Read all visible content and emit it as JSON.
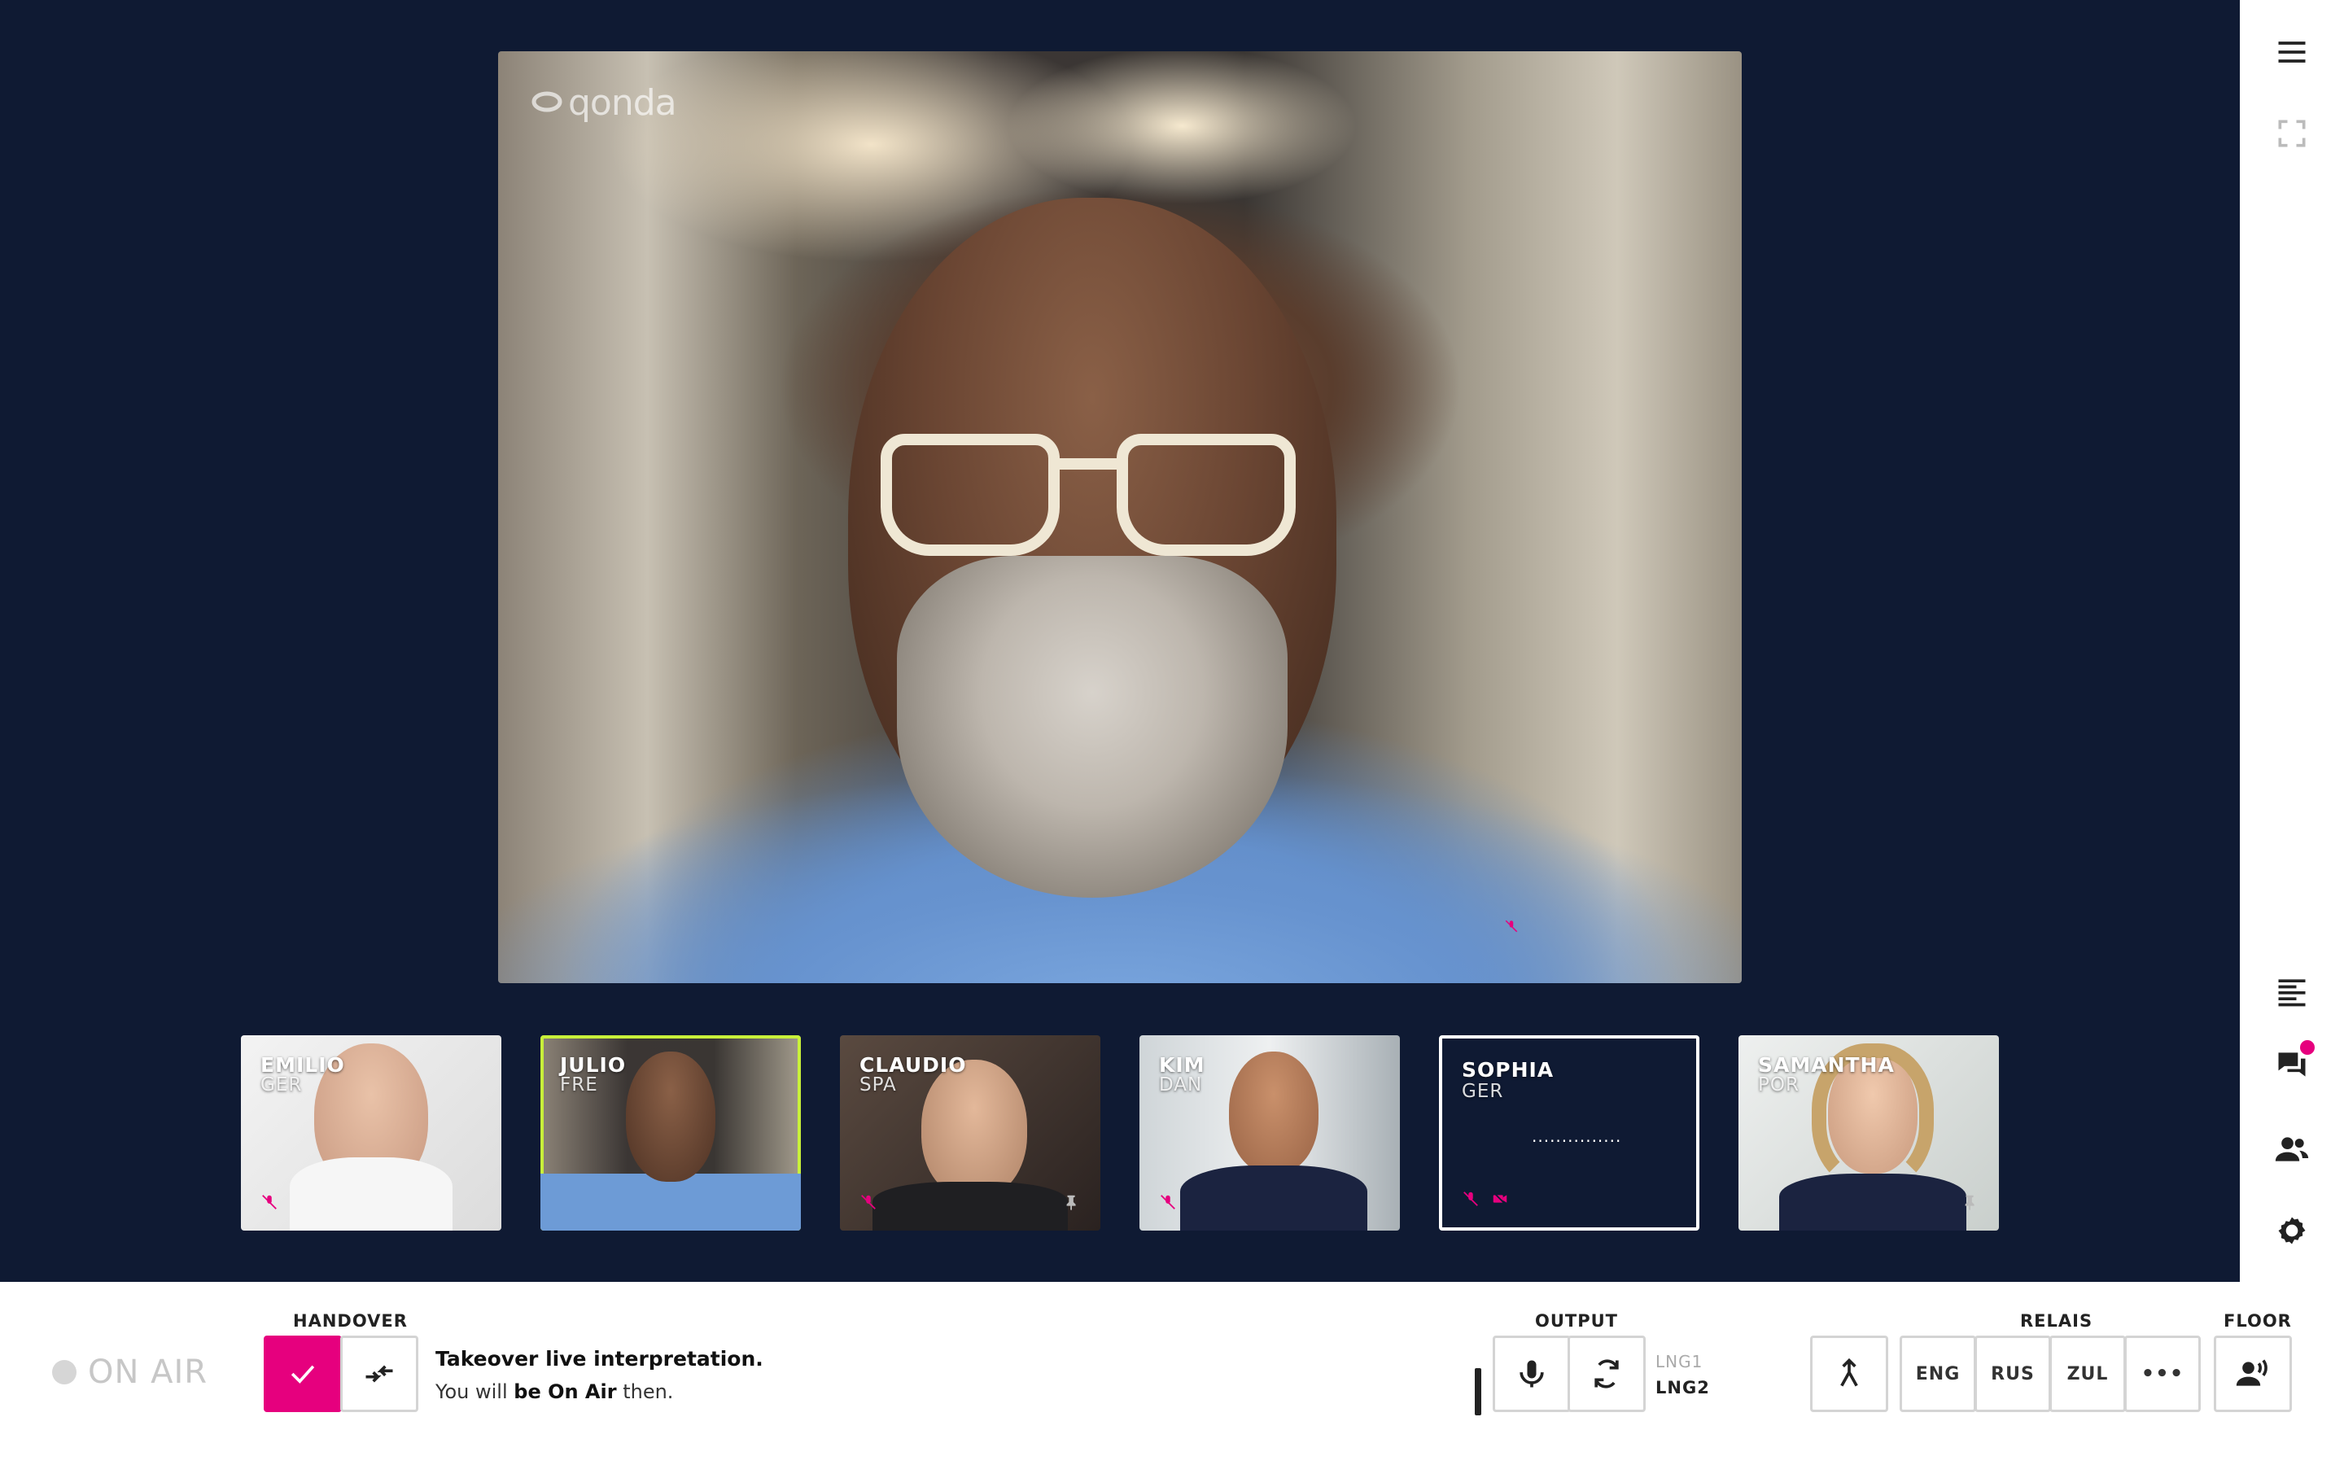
{
  "app": {
    "logo_text": "qonda"
  },
  "participants": [
    {
      "name": "EMILIO",
      "lang": "GER",
      "muted": true,
      "pinned": false,
      "active": false,
      "video": true
    },
    {
      "name": "JULIO",
      "lang": "FRE",
      "muted": false,
      "pinned": false,
      "active": true,
      "video": true
    },
    {
      "name": "CLAUDIO",
      "lang": "SPA",
      "muted": true,
      "pinned": true,
      "active": false,
      "video": true
    },
    {
      "name": "KIM",
      "lang": "DAN",
      "muted": true,
      "pinned": false,
      "active": false,
      "video": true
    },
    {
      "name": "SOPHIA",
      "lang": "GER",
      "muted": true,
      "pinned": false,
      "active": false,
      "video": false,
      "placeholder": "..............."
    },
    {
      "name": "SAMANTHA",
      "lang": "POR",
      "muted": false,
      "pinned": true,
      "active": false,
      "video": true
    }
  ],
  "sidebar": {
    "menu_icon": "hamburger-icon",
    "fullscreen_icon": "fullscreen-icon",
    "transcript_icon": "text-align-icon",
    "chat_icon": "chat-icon",
    "chat_has_notification": true,
    "participants_icon": "people-icon",
    "settings_icon": "gear-icon"
  },
  "bottom_bar": {
    "on_air_label": "ON AIR",
    "handover": {
      "label": "HANDOVER",
      "takeover_title": "Takeover live interpretation.",
      "takeover_sub_prefix": "You will ",
      "takeover_sub_bold": "be On Air",
      "takeover_sub_suffix": " then."
    },
    "output": {
      "label": "OUTPUT",
      "lng1": "LNG1",
      "lng2": "LNG2"
    },
    "relais": {
      "label": "RELAIS",
      "options": [
        "ENG",
        "RUS",
        "ZUL"
      ],
      "more": "•••"
    },
    "floor": {
      "label": "FLOOR"
    }
  },
  "colors": {
    "background": "#0f1a33",
    "accent_pink": "#e6007e",
    "active_border": "#c8f03a"
  }
}
